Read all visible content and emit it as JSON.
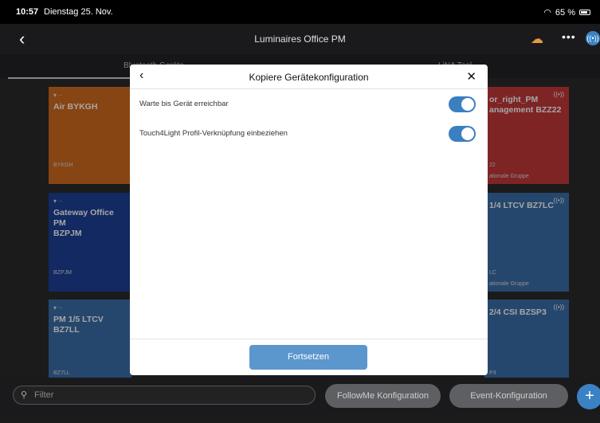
{
  "status_bar": {
    "time": "10:57",
    "date": "Dienstag 25. Nov.",
    "battery": "65 %"
  },
  "nav": {
    "back_icon": "chevron-left-icon",
    "title": "Luminaires Office PM",
    "cloud_icon": "cloud-icon",
    "more_label": "•••",
    "signal_label": "((•))"
  },
  "tabs": [
    {
      "label": "Bluetooth Geräte"
    },
    {
      "label": "LiNA Tool"
    }
  ],
  "cards": [
    {
      "wifi": "▾ ··",
      "name": "Air BYKGH",
      "code": "BYKGH",
      "group": "",
      "color": "#d06a1f"
    },
    {
      "wifi": "",
      "name": "or_right_PM\nanagement BZZ22",
      "code": "22",
      "group": "ationale Gruppe",
      "color": "#c2383a"
    },
    {
      "wifi": "▾ ··",
      "name": "Gateway Office PM\nBZPJM",
      "code": "BZPJM",
      "group": "",
      "color": "#1d3f96"
    },
    {
      "wifi": "",
      "name": "1/4 LTCV BZ7LC",
      "code": "LC",
      "group": "ationale Gruppe",
      "color": "#3b6ea8"
    },
    {
      "wifi": "▾ ··",
      "name": "PM 1/5 LTCV BZ7LL",
      "code": "BZ7LL",
      "group": "",
      "color": "#3b6ea8"
    },
    {
      "wifi": "",
      "name": "2/4 CSI BZSP3",
      "code": "P3",
      "group": "",
      "color": "#3b6ea8"
    }
  ],
  "bottom": {
    "filter_placeholder": "Filter",
    "followme_label": "FollowMe Konfiguration",
    "event_label": "Event-Konfiguration",
    "add_label": "+"
  },
  "modal": {
    "title": "Kopiere Gerätekonfiguration",
    "rows": [
      {
        "label": "Warte bis Gerät erreichbar",
        "on": true
      },
      {
        "label": "Touch4Light Profil-Verknüpfung einbeziehen",
        "on": true
      }
    ],
    "continue_label": "Fortsetzen",
    "accent": "#3b7fc0"
  }
}
